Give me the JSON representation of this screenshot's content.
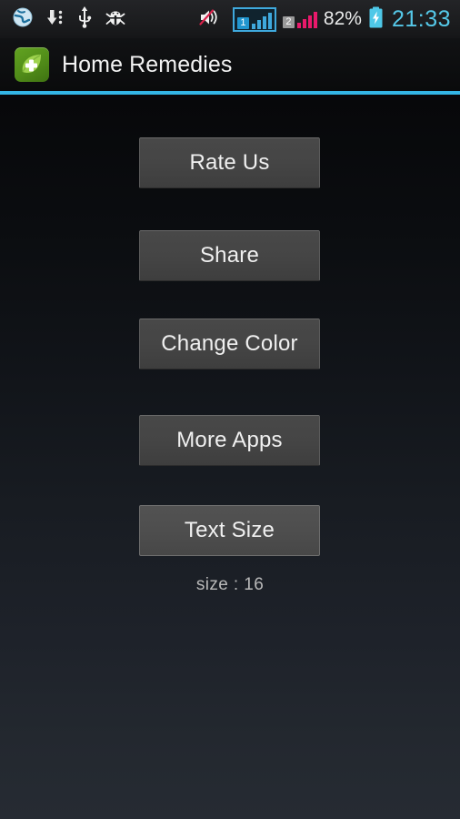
{
  "status_bar": {
    "left_icons": [
      {
        "name": "browser-icon",
        "glyph": "globe"
      },
      {
        "name": "download-icon",
        "glyph": "download"
      },
      {
        "name": "usb-icon",
        "glyph": "usb"
      },
      {
        "name": "android-debug-icon",
        "glyph": "bug"
      }
    ],
    "mute_icon": "speaker-muted-icon",
    "sim1": {
      "label": "1",
      "bars": 4,
      "color": "#3fa9dd"
    },
    "sim2": {
      "label": "2",
      "bars": 4,
      "color": "#e9196b"
    },
    "battery_percent": "82%",
    "battery_icon": "battery-charging-icon",
    "battery_color": "#4ec8e8",
    "clock": "21:33",
    "clock_color": "#55c8e8"
  },
  "action_bar": {
    "app_icon_name": "home-remedies-app-icon",
    "title": "Home Remedies",
    "accent_color": "#33b5e5"
  },
  "main": {
    "buttons": [
      {
        "id": "rate-us",
        "label": "Rate Us",
        "highlighted": false
      },
      {
        "id": "share",
        "label": "Share",
        "highlighted": false
      },
      {
        "id": "change-color",
        "label": "Change Color",
        "highlighted": false
      },
      {
        "id": "more-apps",
        "label": "More Apps",
        "highlighted": false
      },
      {
        "id": "text-size",
        "label": "Text Size",
        "highlighted": true
      }
    ],
    "size_label": "size : 16"
  }
}
